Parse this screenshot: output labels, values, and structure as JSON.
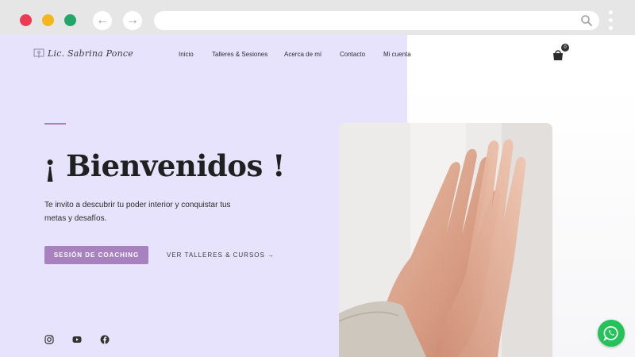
{
  "browser": {
    "back_glyph": "←",
    "forward_glyph": "→",
    "url": ""
  },
  "header": {
    "logo_text": "Lic. Sabrina Ponce",
    "nav": [
      {
        "label": "Inicio"
      },
      {
        "label": "Talleres & Sesiones"
      },
      {
        "label": "Acerca de mí"
      },
      {
        "label": "Contacto"
      },
      {
        "label": "Mi cuenta"
      }
    ],
    "cart_count": "0"
  },
  "hero": {
    "title": "¡ Bienvenidos !",
    "subtitle": "Te invito a descubrir tu poder interior y conquistar tus metas y  desafíos.",
    "primary_cta": "SESIÓN DE COACHING",
    "secondary_cta": "VER TALLERES & CURSOS →"
  },
  "social": [
    "instagram-icon",
    "youtube-icon",
    "facebook-icon"
  ],
  "colors": {
    "lavender": "#e8e3fc",
    "accent": "#a882be",
    "whatsapp": "#25c25a"
  }
}
